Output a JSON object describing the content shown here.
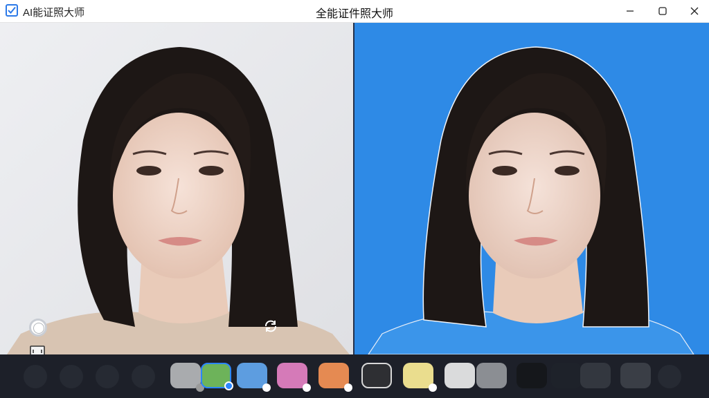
{
  "window": {
    "app_name": "AI能证照大师",
    "title": "全能证件照大师",
    "controls": [
      "minimize-icon",
      "maximize-icon",
      "close-icon"
    ]
  },
  "panes": {
    "left": {
      "role": "original photo",
      "background_color": "#e6e7eb"
    },
    "right": {
      "role": "processed photo",
      "background_color": "#2e8ae6"
    }
  },
  "side_tools": [
    "circle-brush-icon",
    "frame-icon",
    "rotate-icon"
  ],
  "swatches": [
    {
      "color": "#a9abae",
      "selected": false,
      "dot": "#9a9a9a"
    },
    {
      "color": "#6db35a",
      "selected": true,
      "dot": "#2b86ff"
    },
    {
      "color": "#5d9de0",
      "selected": false,
      "dot": "#ffffff"
    },
    {
      "color": "#d57ab8",
      "selected": false,
      "dot": "#ffffff"
    },
    {
      "color": "#e58a52",
      "selected": false,
      "dot": "#ffffff"
    },
    {
      "color": "#2e2f33",
      "selected": false,
      "dot": null
    },
    {
      "color": "#eadd8e",
      "selected": false,
      "dot": "#ffffff"
    },
    {
      "color": "#dadbdc",
      "selected": false,
      "dot": null
    },
    {
      "color": "#8b8e93",
      "selected": false,
      "dot": null
    },
    {
      "color": "#15171b",
      "selected": false,
      "dot": null
    },
    {
      "color": "#1e222a",
      "selected": false,
      "dot": null
    },
    {
      "color": "#33373f",
      "selected": false,
      "dot": null
    },
    {
      "color": "#3a3e46",
      "selected": false,
      "dot": null
    }
  ]
}
